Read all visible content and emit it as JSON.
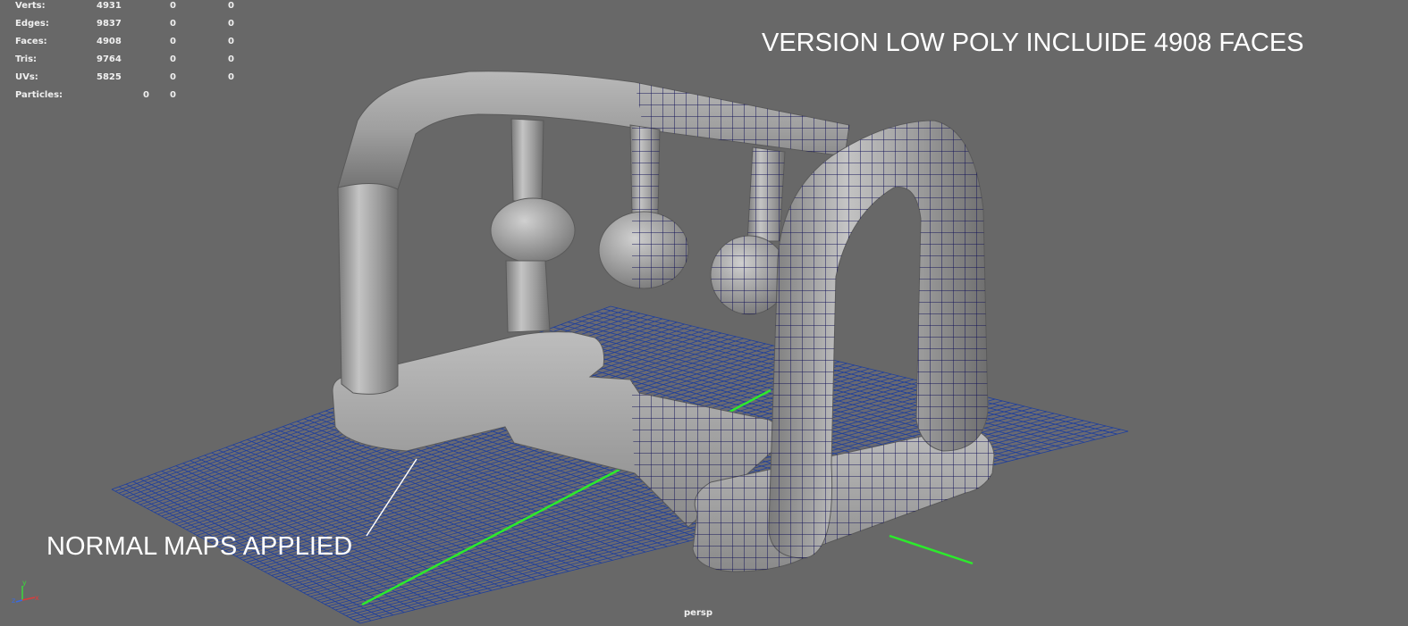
{
  "hud": {
    "verts": {
      "label": "Verts:",
      "v1": "4931",
      "v2": "0",
      "v3": "0"
    },
    "edges": {
      "label": "Edges:",
      "v1": "9837",
      "v2": "0",
      "v3": "0"
    },
    "faces": {
      "label": "Faces:",
      "v1": "4908",
      "v2": "0",
      "v3": "0"
    },
    "tris": {
      "label": "Tris:",
      "v1": "9764",
      "v2": "0",
      "v3": "0"
    },
    "uvs": {
      "label": "UVs:",
      "v1": "5825",
      "v2": "0",
      "v3": "0"
    },
    "particles": {
      "label": "Particles:",
      "v1": "0",
      "v2": "0"
    }
  },
  "annotations": {
    "headline": "VERSION LOW POLY INCLUIDE 4908 FACES",
    "caption": "NORMAL MAPS APPLIED"
  },
  "camera": {
    "name": "persp"
  },
  "axis": {
    "y": "y",
    "z": "z",
    "x": "x"
  },
  "colors": {
    "viewport_bg": "#686868",
    "grid": "#1e3f9c",
    "x_axis_line": "#22dd22",
    "wire": "#101050",
    "model_fill": "#a7a7a7",
    "text": "#ffffff"
  }
}
